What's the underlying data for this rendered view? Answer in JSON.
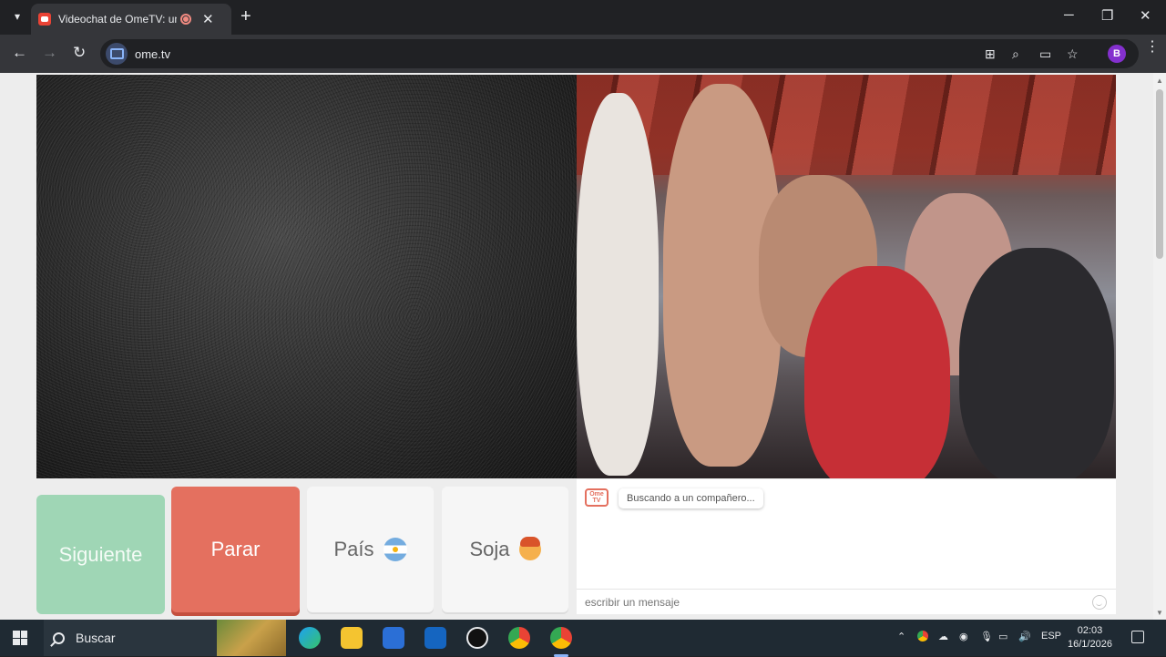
{
  "browser": {
    "tab_title": "Videochat de OmeTV: una a",
    "url": "ome.tv",
    "profile_initial": "B",
    "new_tab": "+",
    "tab_close": "✕"
  },
  "page": {
    "buttons": {
      "next": "Siguiente",
      "stop": "Parar",
      "country": "País",
      "gender": "Soja"
    },
    "chat": {
      "logo_text": "Ome TV",
      "status_message": "Buscando a un compañero...",
      "input_placeholder": "escribir un mensaje"
    }
  },
  "taskbar": {
    "search_label": "Buscar",
    "language": "ESP",
    "time": "02:03",
    "date": "16/1/2026"
  },
  "colors": {
    "next_button": "#9fd6b5",
    "stop_button": "#e4705f",
    "neutral_button": "#f6f6f6"
  },
  "icons": [
    "chrome-tab-menu-icon",
    "ometv-favicon-icon",
    "recording-icon",
    "close-icon",
    "back-icon",
    "forward-icon",
    "reload-icon",
    "translate-icon",
    "zoom-icon",
    "cast-icon",
    "bookmark-star-icon",
    "kebab-menu-icon",
    "argentina-flag-icon",
    "boy-face-icon",
    "emoji-icon",
    "windows-start-icon",
    "search-icon"
  ]
}
